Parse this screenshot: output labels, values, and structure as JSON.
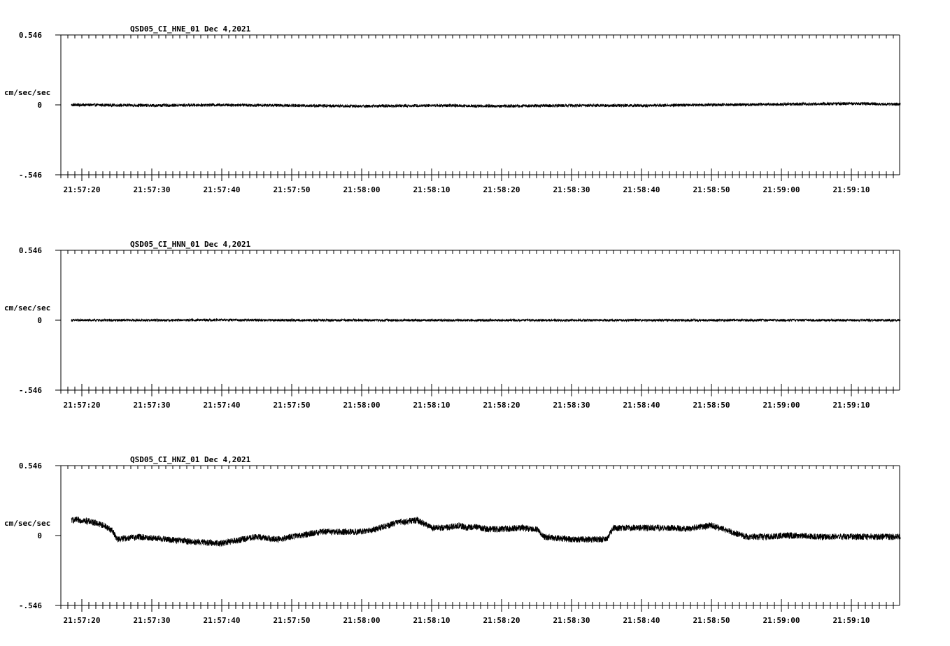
{
  "chart_data": [
    {
      "type": "line",
      "title": "QSD05_CI_HNE_01  Dec 4,2021",
      "ylabel": "cm/sec/sec",
      "ylim": [
        -0.546,
        0.546
      ],
      "y_ticks": [
        "0.546",
        "0",
        "-.546"
      ],
      "x_ticks": [
        "21:57:20",
        "21:57:30",
        "21:57:40",
        "21:57:50",
        "21:58:00",
        "21:58:10",
        "21:58:20",
        "21:58:30",
        "21:58:40",
        "21:58:50",
        "21:59:00",
        "21:59:10"
      ],
      "xlim_seconds_from_first_tick": [
        -3,
        117
      ],
      "series": [
        {
          "x_seconds": [
            -1.5,
            0,
            10,
            20,
            30,
            40,
            50,
            60,
            70,
            80,
            90,
            100,
            110,
            117
          ],
          "values": [
            0.0,
            0.0,
            -0.005,
            0.0,
            -0.005,
            -0.01,
            -0.005,
            -0.01,
            -0.005,
            -0.005,
            0.0,
            0.005,
            0.01,
            0.005
          ],
          "noise_amplitude": 0.012
        }
      ]
    },
    {
      "type": "line",
      "title": "QSD05_CI_HNN_01  Dec 4,2021",
      "ylabel": "cm/sec/sec",
      "ylim": [
        -0.546,
        0.546
      ],
      "y_ticks": [
        "0.546",
        "0",
        "-.546"
      ],
      "x_ticks": [
        "21:57:20",
        "21:57:30",
        "21:57:40",
        "21:57:50",
        "21:58:00",
        "21:58:10",
        "21:58:20",
        "21:58:30",
        "21:58:40",
        "21:58:50",
        "21:59:00",
        "21:59:10"
      ],
      "xlim_seconds_from_first_tick": [
        -3,
        117
      ],
      "series": [
        {
          "x_seconds": [
            -1.5,
            0,
            10,
            20,
            30,
            40,
            50,
            60,
            70,
            80,
            90,
            100,
            110,
            117
          ],
          "values": [
            0.0,
            0.0,
            0.0,
            0.002,
            0.0,
            0.0,
            0.0,
            0.0,
            0.0,
            0.0,
            0.0,
            0.0,
            0.0,
            0.0
          ],
          "noise_amplitude": 0.01
        }
      ]
    },
    {
      "type": "line",
      "title": "QSD05_CI_HNZ_01  Dec 4,2021",
      "ylabel": "cm/sec/sec",
      "ylim": [
        -0.546,
        0.546
      ],
      "y_ticks": [
        "0.546",
        "0",
        "-.546"
      ],
      "x_ticks": [
        "21:57:20",
        "21:57:30",
        "21:57:40",
        "21:57:50",
        "21:58:00",
        "21:58:10",
        "21:58:20",
        "21:58:30",
        "21:58:40",
        "21:58:50",
        "21:59:00",
        "21:59:10"
      ],
      "xlim_seconds_from_first_tick": [
        -3,
        117
      ],
      "series": [
        {
          "x_seconds": [
            -1.5,
            0,
            2,
            3.5,
            4.5,
            5,
            8,
            12,
            16,
            20,
            22,
            25,
            28,
            31,
            34.5,
            35,
            40,
            42,
            45,
            48,
            50,
            52,
            54,
            55,
            56,
            58,
            60,
            63,
            65,
            66,
            70,
            72,
            75,
            76,
            80,
            83,
            85,
            86,
            90,
            95,
            98,
            100,
            103,
            105,
            108,
            110,
            112,
            115,
            117
          ],
          "values": [
            0.12,
            0.12,
            0.1,
            0.07,
            0.03,
            -0.03,
            -0.01,
            -0.03,
            -0.05,
            -0.06,
            -0.04,
            -0.01,
            -0.03,
            0.0,
            0.03,
            0.03,
            0.03,
            0.05,
            0.1,
            0.12,
            0.06,
            0.06,
            0.08,
            0.06,
            0.07,
            0.05,
            0.05,
            0.06,
            0.05,
            -0.01,
            -0.03,
            -0.03,
            -0.03,
            0.06,
            0.06,
            0.06,
            0.06,
            0.05,
            0.08,
            -0.01,
            -0.01,
            0.0,
            0.0,
            -0.01,
            -0.01,
            -0.01,
            -0.01,
            -0.01,
            -0.01
          ],
          "noise_amplitude": 0.025
        }
      ]
    }
  ]
}
